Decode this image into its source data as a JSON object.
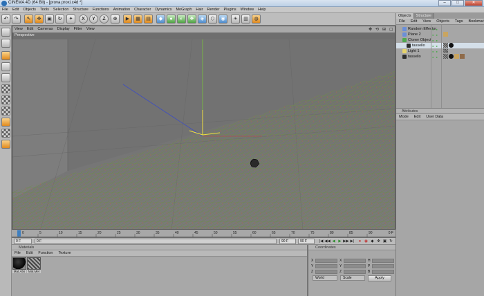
{
  "window": {
    "title": "CINEMA 4D (64 Bit) - [prova proxi.c4d *]",
    "minimize": "–",
    "maximize": "□",
    "close": "✕"
  },
  "menubar": [
    "File",
    "Edit",
    "Objects",
    "Tools",
    "Selection",
    "Structure",
    "Functions",
    "Animation",
    "Character",
    "Dynamics",
    "MoGraph",
    "Hair",
    "Render",
    "Plugins",
    "Window",
    "Help"
  ],
  "toolbar": {
    "axis_x": "X",
    "axis_y": "Y",
    "axis_z": "Z"
  },
  "viewport": {
    "menu": [
      "View",
      "Edit",
      "Cameras",
      "Display",
      "Filter",
      "View"
    ],
    "label": "Perspective",
    "nav_icons": [
      "✥",
      "⟲",
      "⊞",
      "▢"
    ]
  },
  "timeline": {
    "ticks": [
      "0",
      "5",
      "10",
      "15",
      "20",
      "25",
      "30",
      "35",
      "40",
      "45",
      "50",
      "55",
      "60",
      "65",
      "70",
      "75",
      "80",
      "85",
      "90"
    ],
    "end_label": "0 F"
  },
  "transport": {
    "start_field": "0 F",
    "current_field": "0 F",
    "end_field": "90 F",
    "end_field2": "90 F",
    "buttons": [
      "|◀",
      "◀◀",
      "◀",
      "▶",
      "▶▶",
      "▶|"
    ]
  },
  "materials": {
    "header": "Materials",
    "menu": [
      "File",
      "Edit",
      "Function",
      "Texture"
    ],
    "items": [
      {
        "name": "Mat.Abs",
        "color": "#1a1a1a"
      },
      {
        "name": "Mat.Met",
        "color": "#888888"
      }
    ]
  },
  "coordinates": {
    "header": "Coordinates",
    "rows": [
      {
        "a": "X",
        "av": "0 cm",
        "b": "X",
        "bv": "0 cm",
        "c": "H",
        "cv": "0°"
      },
      {
        "a": "Y",
        "av": "0 cm",
        "b": "Y",
        "bv": "0 cm",
        "c": "P",
        "cv": "0°"
      },
      {
        "a": "Z",
        "av": "0 cm",
        "b": "Z",
        "bv": "0 cm",
        "c": "B",
        "cv": "0°"
      }
    ],
    "mode1": "World",
    "mode2": "Scale",
    "apply": "Apply"
  },
  "objects_panel": {
    "tabs": [
      "Objects",
      "Structure"
    ],
    "menu": [
      "File",
      "Edit",
      "View",
      "Objects",
      "Tags",
      "Bookmarks"
    ],
    "items": [
      {
        "name": "Random Effector",
        "indent": 0,
        "color": "#6a8fd8"
      },
      {
        "name": "Plane 2",
        "indent": 0,
        "color": "#6a8fd8"
      },
      {
        "name": "Cloner Object",
        "indent": 0,
        "color": "#4fa84f"
      },
      {
        "name": "tassello",
        "indent": 1,
        "color": "#2d2d2d"
      },
      {
        "name": "Light 1",
        "indent": 0,
        "color": "#e6d36a"
      },
      {
        "name": "tassello",
        "indent": 0,
        "color": "#2d2d2d"
      }
    ]
  },
  "attributes_panel": {
    "header": "Attributes",
    "menu": [
      "Mode",
      "Edit",
      "User Data"
    ]
  },
  "colors": {
    "axis_x": "#c43c3c",
    "axis_y": "#7ac23c",
    "axis_z": "#3c4cc4",
    "mesh": "#6f8a4a"
  }
}
